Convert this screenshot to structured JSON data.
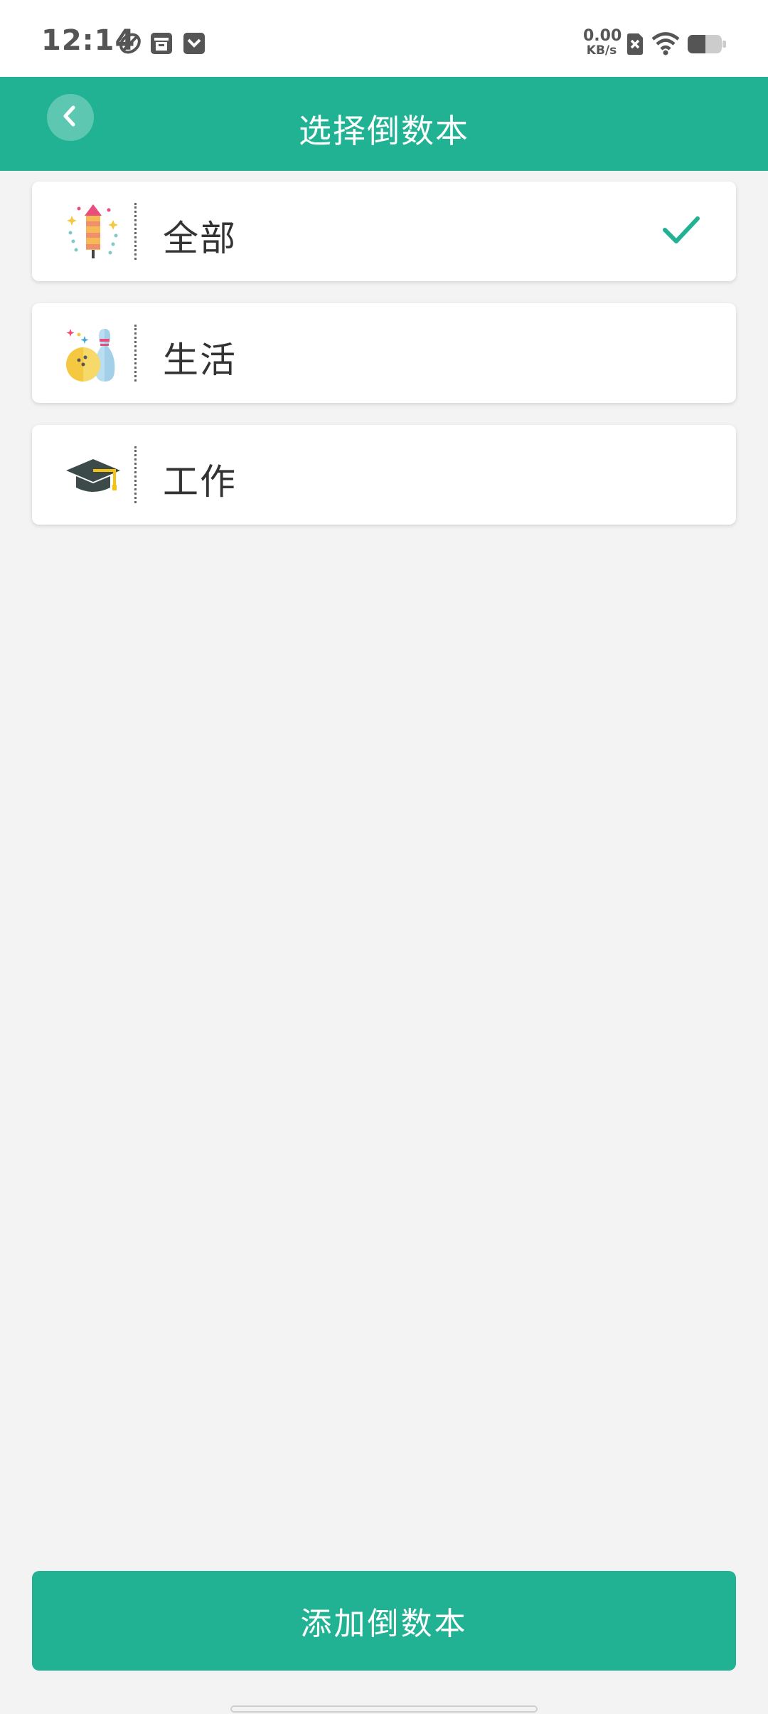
{
  "status_bar": {
    "time": "12:14",
    "net_speed_value": "0.00",
    "net_speed_unit": "KB/s",
    "icons": [
      "leaf-icon",
      "archive-icon",
      "notification-icon",
      "sim-off-icon",
      "wifi-icon",
      "battery-icon"
    ]
  },
  "header": {
    "title": "选择倒数本",
    "back_icon": "chevron-left-icon"
  },
  "categories": [
    {
      "label": "全部",
      "icon": "firework-icon",
      "selected": true
    },
    {
      "label": "生活",
      "icon": "bowling-icon",
      "selected": false
    },
    {
      "label": "工作",
      "icon": "graduation-cap-icon",
      "selected": false
    }
  ],
  "add_button": {
    "label": "添加倒数本"
  },
  "colors": {
    "accent": "#21b293",
    "background": "#f3f3f4",
    "card": "#ffffff"
  }
}
